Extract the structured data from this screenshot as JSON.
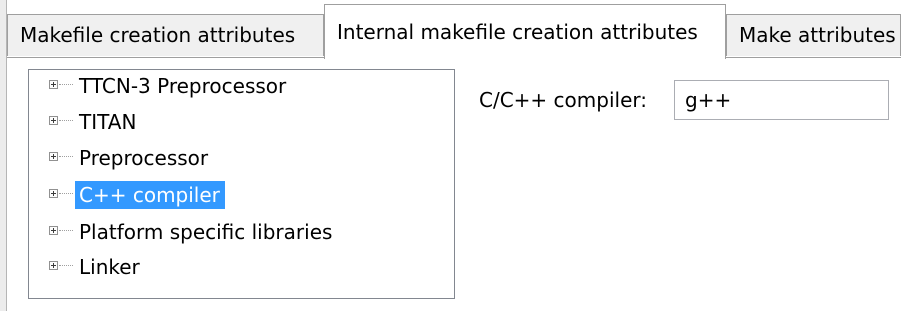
{
  "tabs": [
    {
      "label": "Makefile creation attributes",
      "active": false
    },
    {
      "label": "Internal makefile creation attributes",
      "active": true
    },
    {
      "label": "Make attributes",
      "active": false
    }
  ],
  "tree": {
    "items": [
      {
        "label": "TTCN-3 Preprocessor",
        "selected": false
      },
      {
        "label": "TITAN",
        "selected": false
      },
      {
        "label": "Preprocessor",
        "selected": false
      },
      {
        "label": "C++ compiler",
        "selected": true
      },
      {
        "label": "Platform specific libraries",
        "selected": false
      },
      {
        "label": "Linker",
        "selected": false
      }
    ]
  },
  "form": {
    "compiler_label": "C/C++ compiler:",
    "compiler_value": "g++"
  },
  "colors": {
    "selection": "#3399ff",
    "selection_text": "#ffffff",
    "tab_inactive_bg": "#f0f0f0",
    "border": "#9f9f9f"
  }
}
